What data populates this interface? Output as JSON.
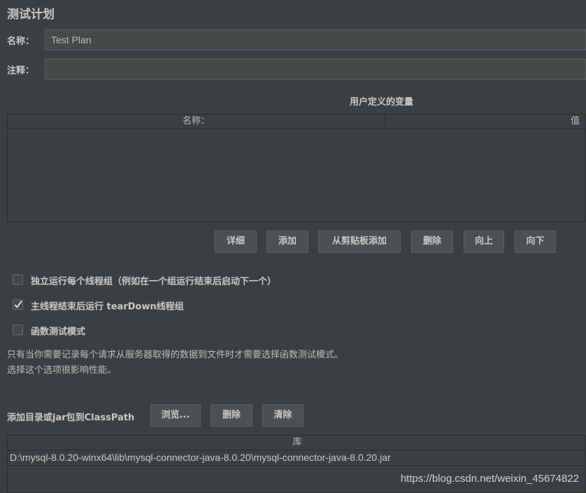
{
  "panel": {
    "title": "测试计划"
  },
  "fields": {
    "name_label": "名称：",
    "name_value": "Test Plan",
    "comment_label": "注释：",
    "comment_value": ""
  },
  "user_vars": {
    "title": "用户定义的变量",
    "columns": [
      "名称：",
      "值"
    ],
    "rows": [],
    "buttons": {
      "detail": "详细",
      "add": "添加",
      "add_clipboard": "从剪贴板添加",
      "delete": "删除",
      "up": "向上",
      "down": "向下"
    }
  },
  "options": {
    "independent_threads": {
      "label": "独立运行每个线程组（例如在一个组运行结束后启动下一个）",
      "checked": false
    },
    "teardown_after_main": {
      "label": "主线程结束后运行 tearDown线程组",
      "checked": true
    },
    "functional_mode": {
      "label": "函数测试模式",
      "checked": false
    }
  },
  "notes": {
    "line1": "只有当你需要记录每个请求从服务器取得的数据到文件时才需要选择函数测试模式。",
    "line2": "选择这个选项很影响性能。"
  },
  "classpath": {
    "label": "添加目录或jar包到ClassPath",
    "browse": "浏览...",
    "delete": "删除",
    "clear": "清除",
    "column": "库",
    "rows": [
      "D:\\mysql-8.0.20-winx64\\lib\\mysql-connector-java-8.0.20\\mysql-connector-java-8.0.20.jar"
    ]
  },
  "watermark": "https://blog.csdn.net/weixin_45674822"
}
